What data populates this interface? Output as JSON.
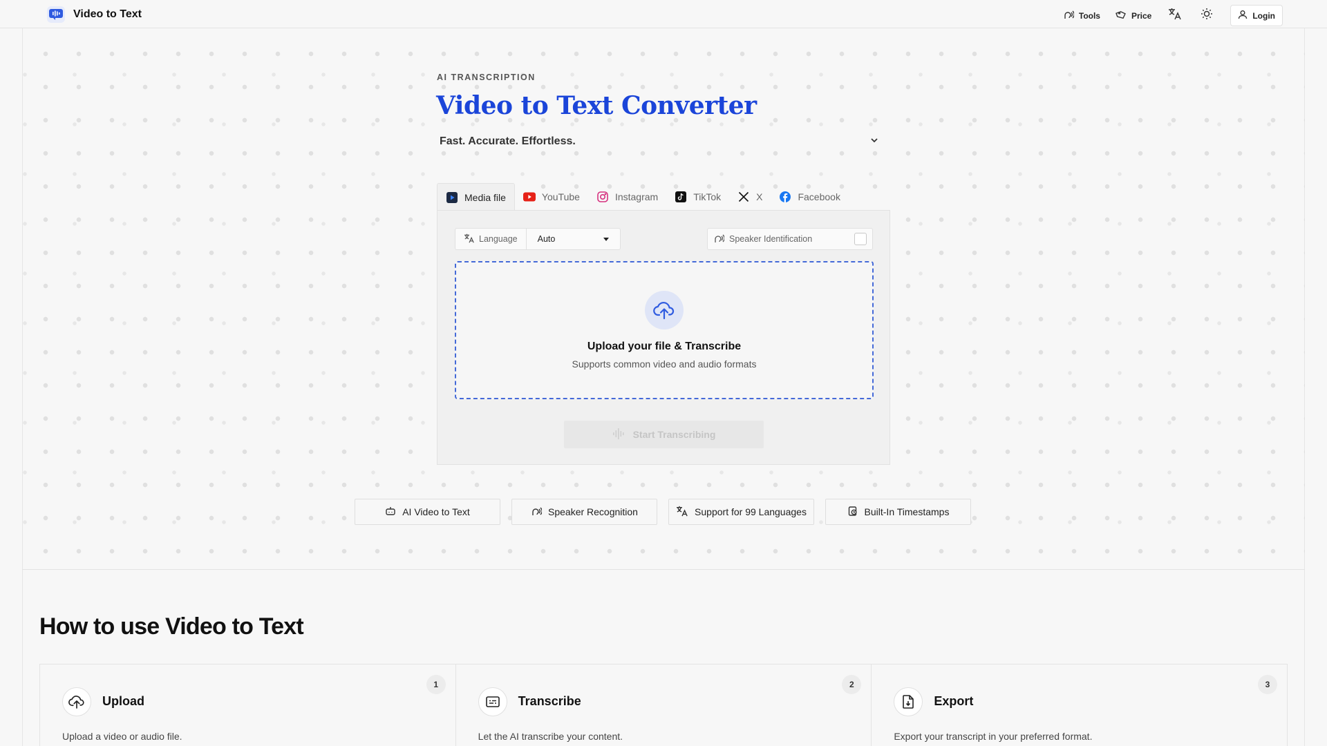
{
  "header": {
    "brand": "Video to Text",
    "nav": {
      "tools": "Tools",
      "price": "Price",
      "login": "Login"
    }
  },
  "hero": {
    "eyebrow": "AI TRANSCRIPTION",
    "title": "Video to Text Converter",
    "subtitle": "Fast. Accurate. Effortless."
  },
  "tabs": [
    {
      "label": "Media file",
      "icon": "media-file-icon",
      "active": true
    },
    {
      "label": "YouTube",
      "icon": "youtube-icon"
    },
    {
      "label": "Instagram",
      "icon": "instagram-icon"
    },
    {
      "label": "TikTok",
      "icon": "tiktok-icon"
    },
    {
      "label": "X",
      "icon": "x-icon"
    },
    {
      "label": "Facebook",
      "icon": "facebook-icon"
    }
  ],
  "panel": {
    "language_label": "Language",
    "language_value": "Auto",
    "speaker_label": "Speaker Identification",
    "speaker_checked": false,
    "dropzone_title": "Upload your file & Transcribe",
    "dropzone_subtitle": "Supports common video and audio formats",
    "start_button": "Start Transcribing"
  },
  "features": [
    {
      "label": "AI Video to Text",
      "icon": "robot-icon"
    },
    {
      "label": "Speaker Recognition",
      "icon": "speaker-icon"
    },
    {
      "label": "Support for 99 Languages",
      "icon": "translate-icon"
    },
    {
      "label": "Built-In Timestamps",
      "icon": "timestamp-icon"
    }
  ],
  "how_to": {
    "title": "How to use Video to Text",
    "steps": [
      {
        "number": "1",
        "title": "Upload",
        "description": "Upload a video or audio file.",
        "icon": "upload-cloud-icon"
      },
      {
        "number": "2",
        "title": "Transcribe",
        "description": "Let the AI transcribe your content.",
        "icon": "captions-icon"
      },
      {
        "number": "3",
        "title": "Export",
        "description": "Export your transcript in your preferred format.",
        "icon": "file-download-icon"
      }
    ]
  },
  "colors": {
    "accent": "#1b45d9",
    "youtube": "#e62117",
    "facebook": "#1877f2",
    "dropzone_border": "#4469d8"
  }
}
